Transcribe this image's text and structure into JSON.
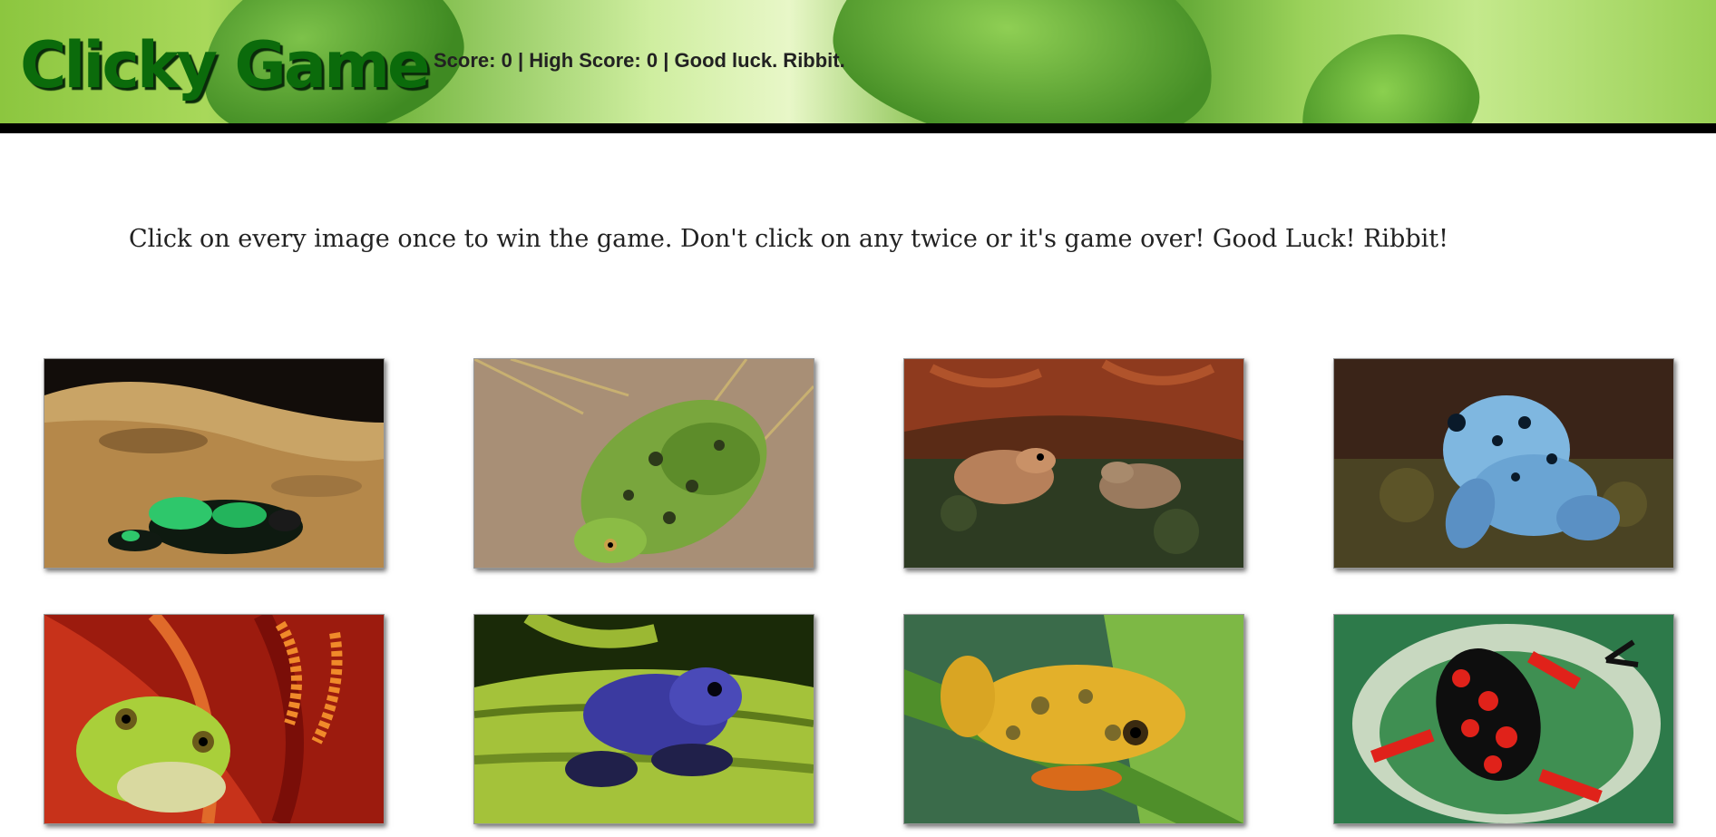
{
  "header": {
    "brand": "Clicky Game",
    "score_label": "Score:",
    "score": 0,
    "high_score_label": "High Score:",
    "high_score": 0,
    "message": "Good luck. Ribbit."
  },
  "instructions": "Click on every image once to win the game. Don't click on any twice or it's game over! Good Luck! Ribbit!",
  "cards": [
    {
      "name": "card-green-black-dart-frog",
      "icon": "green-black-poison-dart-frog-image"
    },
    {
      "name": "card-green-spotted-frog",
      "icon": "green-spotted-frog-image"
    },
    {
      "name": "card-brown-wood-frogs",
      "icon": "brown-wood-frogs-image"
    },
    {
      "name": "card-blue-dart-frog",
      "icon": "blue-poison-dart-frog-image"
    },
    {
      "name": "card-green-tree-frog-red-flower",
      "icon": "green-tree-frog-in-red-flower-image"
    },
    {
      "name": "card-blue-dart-frog-on-leaf",
      "icon": "dark-blue-dart-frog-on-leaf-image"
    },
    {
      "name": "card-yellow-reed-frog",
      "icon": "yellow-patterned-reed-frog-image"
    },
    {
      "name": "card-red-black-dart-frog",
      "icon": "red-black-poison-dart-frog-image"
    }
  ]
}
